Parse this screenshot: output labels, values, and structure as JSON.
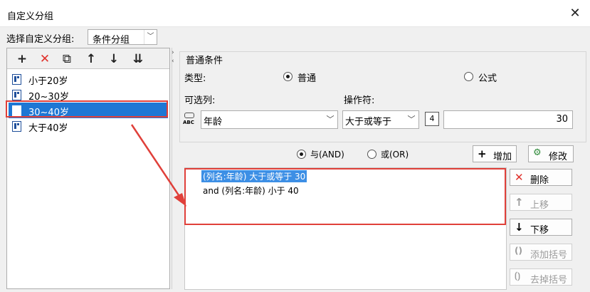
{
  "window": {
    "title": "自定义分组",
    "close_glyph": "✕"
  },
  "group_selector": {
    "label": "选择自定义分组:",
    "value": "条件分组"
  },
  "toolbar": {
    "add": "+",
    "delete": "✕",
    "copy": "⧉",
    "up": "↑",
    "down": "↓",
    "sort": "⇊"
  },
  "tree": {
    "items": [
      {
        "label": "小于20岁"
      },
      {
        "label": "20~30岁"
      },
      {
        "label": "30~40岁"
      },
      {
        "label": "大于40岁"
      }
    ],
    "selected_index": 2
  },
  "condition": {
    "section_title": "普通条件",
    "type_label": "类型:",
    "type_normal": "普通",
    "type_formula": "公式",
    "column_label": "可选列:",
    "column_value": "年龄",
    "operator_label": "操作符:",
    "operator_value": "大于或等于",
    "value_type_badge": "4",
    "value": "30",
    "and_label": "与(AND)",
    "or_label": "或(OR)",
    "add_button": "增加",
    "modify_button": "修改"
  },
  "conditions_list": [
    "(列名:年龄) 大于或等于 30",
    "and (列名:年龄) 小于 40"
  ],
  "side_buttons": {
    "delete": "删除",
    "move_up": "上移",
    "move_down": "下移",
    "add_bracket": "添加括号",
    "remove_bracket": "去掉括号"
  },
  "colors": {
    "selection": "#1e77d4",
    "highlight_box": "#e0403a",
    "delete_icon": "#e0302a"
  }
}
